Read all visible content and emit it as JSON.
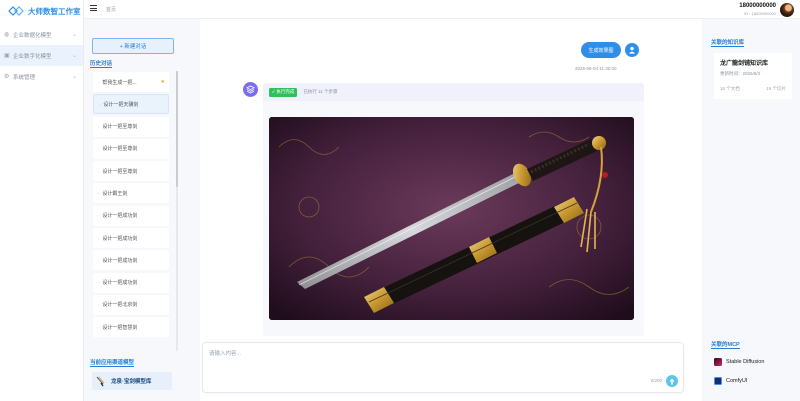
{
  "brand": {
    "title": "大师数智工作室"
  },
  "nav": {
    "items": [
      {
        "label": "企业数据化模型",
        "icon": "globe-icon",
        "active": false
      },
      {
        "label": "企业数字化模型",
        "icon": "store-icon",
        "active": true
      },
      {
        "label": "系统管理",
        "icon": "gear-icon",
        "active": false
      }
    ]
  },
  "topbar": {
    "breadcrumb": "首页",
    "user_phone": "18000000000",
    "user_id": "ID : 18000000000"
  },
  "history": {
    "new_chat_label": "+ 新建对话",
    "title": "历史对话",
    "items": [
      {
        "label": "帮我生成一把...",
        "starred": true,
        "selected": false
      },
      {
        "label": "设计一把天骥剑",
        "starred": false,
        "selected": true
      },
      {
        "label": "设计一把至尊剑",
        "starred": false,
        "selected": false
      },
      {
        "label": "设计一把至尊剑",
        "starred": false,
        "selected": false
      },
      {
        "label": "设计一把至尊剑",
        "starred": false,
        "selected": false
      },
      {
        "label": "设计霸王剑",
        "starred": false,
        "selected": false
      },
      {
        "label": "设计一把成功剑",
        "starred": false,
        "selected": false
      },
      {
        "label": "设计一把成功剑",
        "starred": false,
        "selected": false
      },
      {
        "label": "设计一把成功剑",
        "starred": false,
        "selected": false
      },
      {
        "label": "设计一把成功剑",
        "starred": false,
        "selected": false
      },
      {
        "label": "设计一把北京剑",
        "starred": false,
        "selected": false
      },
      {
        "label": "设计一把智慧剑",
        "starred": false,
        "selected": false
      }
    ],
    "model_section_title": "当前应用渠道模型",
    "model_label": "龙泉·宝剑模型库"
  },
  "chat": {
    "user_message": "生成效果图",
    "timestamp": "2025-06-04 11:30:00",
    "status_badge": "✓ 执行完成",
    "status_text": "已执行 11 个步骤",
    "image_alt": "sword-render",
    "input_placeholder": "请输入内容...",
    "char_count": "0/200"
  },
  "right": {
    "kb_section_title": "关联的知识库",
    "kb": {
      "title": "龙广龍剑铺知识库",
      "updated": "更新时间：2025/6/3",
      "docs": "16 个文档",
      "segments": "16 个切片"
    },
    "mcp_section_title": "关联的MCP",
    "mcp": [
      {
        "label": "Stable Diffusion",
        "icon": "stable-diffusion-icon"
      },
      {
        "label": "ComfyUI",
        "icon": "comfyui-icon"
      }
    ]
  },
  "colors": {
    "accent": "#2f8fe8",
    "success": "#2fbf5b",
    "bot": "#7b6cf0"
  }
}
